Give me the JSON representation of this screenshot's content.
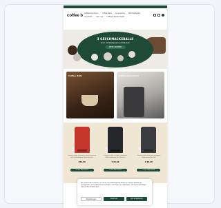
{
  "header": {
    "logo": "coffee b",
    "nav": [
      "Kaffeemaschinen",
      "Coffee Balls",
      "Accessoires",
      "Nachhaltigkeit",
      "Angebote",
      "Über uns",
      "Coffee B Erlebniswelt"
    ]
  },
  "hero": {
    "title": "3 GESCHMACKSBALLS",
    "subtitle": "zum Vorteilspreis entdecken",
    "badge": "JETZT SICHERN"
  },
  "tiles": [
    {
      "label": "Coffee Balls"
    },
    {
      "label": "Kaffeemaschinen"
    }
  ],
  "products": [
    {
      "desc": "CoffeeB Globe kompakte Kaffeemaschine mit nachhaltigem Kapselsystem",
      "price": "€99,00",
      "button": "In den Warenkorb",
      "color": "#c5362c"
    },
    {
      "desc": "CoffeeB Globe Schwarz kompakte Kaffeemaschine für Zuhause",
      "price": "€ 99,00",
      "button": "In den Warenkorb",
      "color": "#26272a"
    },
    {
      "desc": "CoffeeB Globe Anthrazit kompakte Kaffeemaschine Set",
      "price": "€ 99,00",
      "button": "In den Warenkorb",
      "color": "#3a3b3e"
    }
  ],
  "cookie": {
    "text": "Wir verwenden Cookies, um Ihnen die bestmögliche Nutzung unserer Website zu ermöglichen und unsere Kommunikation mit Ihnen zu verbessern. Wir berücksichtigen hierbei Ihre Präferenzen.",
    "settings": "Einstellungen",
    "reject": "Ablehnen",
    "accept": "Alle akzeptieren"
  },
  "colors": {
    "brand": "#1e4a3a",
    "cream": "#efe7d4"
  }
}
